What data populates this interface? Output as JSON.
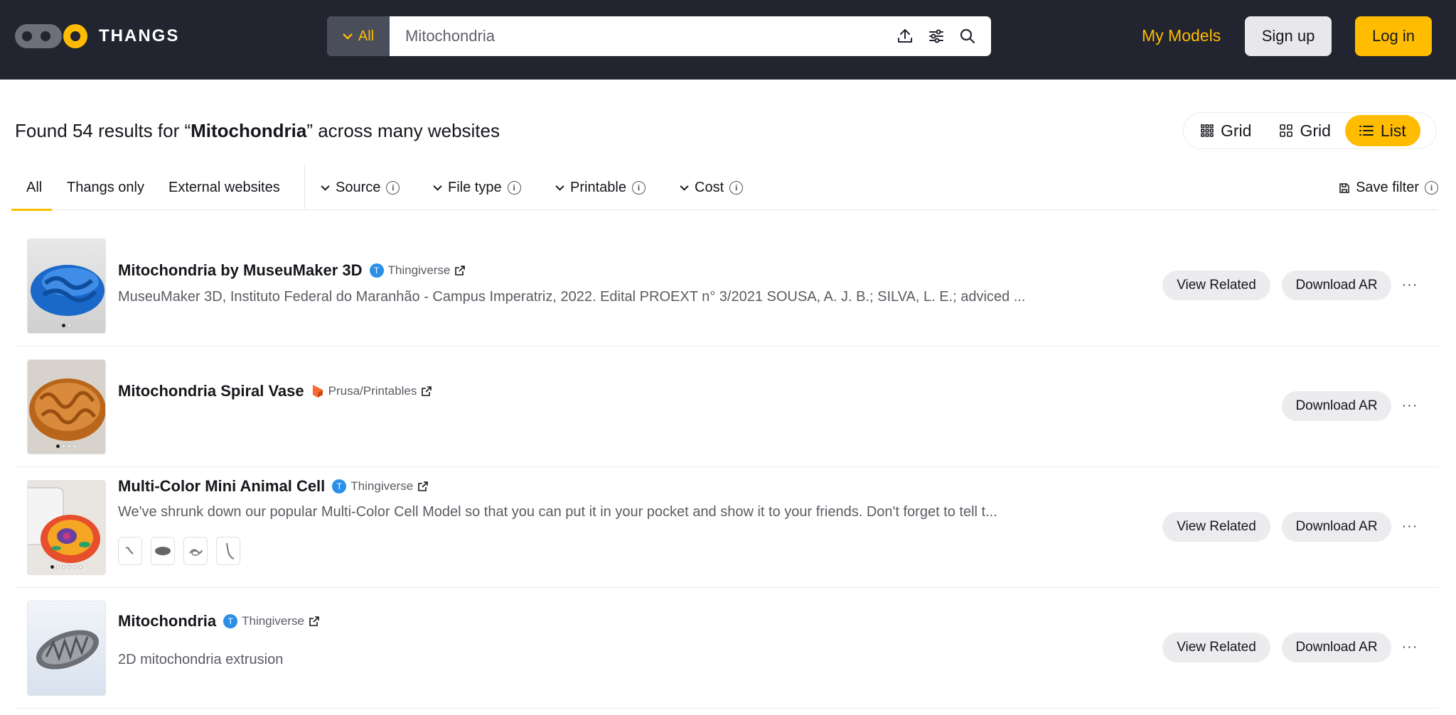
{
  "header": {
    "brand": "THANGS",
    "search_scope": "All",
    "search_value": "Mitochondria",
    "my_models": "My Models",
    "signup": "Sign up",
    "login": "Log in"
  },
  "results": {
    "prefix": "Found 54 results for “",
    "query": "Mitochondria",
    "suffix": "” across many websites"
  },
  "view_toggle": [
    {
      "label": "Grid",
      "icon": "dense-grid-icon",
      "active": false
    },
    {
      "label": "Grid",
      "icon": "grid-icon",
      "active": false
    },
    {
      "label": "List",
      "icon": "list-icon",
      "active": true
    }
  ],
  "filters": {
    "tabs": [
      "All",
      "Thangs only",
      "External websites"
    ],
    "dropdowns": [
      "Source",
      "File type",
      "Printable",
      "Cost"
    ],
    "save_filter": "Save filter"
  },
  "items": [
    {
      "title": "Mitochondria by MuseuMaker 3D",
      "source": "Thingiverse",
      "description": "MuseuMaker 3D, Instituto Federal do Maranhão - Campus Imperatriz, 2022. Edital PROEXT n° 3/2021 SOUSA, A. J. B.; SILVA, L. E.; adviced ...",
      "view_related": "View Related",
      "download": "Download AR"
    },
    {
      "title": "Mitochondria Spiral Vase",
      "source": "Prusa/Printables",
      "description": "",
      "view_related": "",
      "download": "Download AR"
    },
    {
      "title": "Multi-Color Mini Animal Cell",
      "source": "Thingiverse",
      "description": "We've shrunk down our popular Multi-Color Cell Model so that you can put it in your pocket and show it to your friends. Don't forget to tell t...",
      "view_related": "View Related",
      "download": "Download AR"
    },
    {
      "title": "Mitochondria",
      "source": "Thingiverse",
      "description": "2D mitochondria extrusion",
      "view_related": "View Related",
      "download": "Download AR"
    }
  ],
  "colors": {
    "accent": "#ffbc00",
    "topbar": "#22242f",
    "thingiverse": "#2b8fe8",
    "printables": "#fa6831"
  }
}
